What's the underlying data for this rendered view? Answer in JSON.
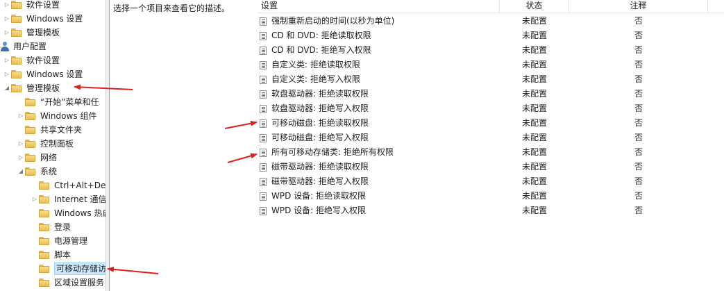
{
  "tree": [
    {
      "label": "软件设置",
      "toggle": "expand",
      "icon": "folder-icon",
      "name": "tree-software-settings-1"
    },
    {
      "label": "Windows 设置",
      "toggle": "expand",
      "icon": "folder-icon",
      "name": "tree-windows-settings-1"
    },
    {
      "label": "管理模板",
      "toggle": "expand",
      "icon": "folder-icon",
      "name": "tree-admin-templates-1"
    },
    {
      "label": "用户配置",
      "toggle": "none",
      "icon": "user-config-icon",
      "name": "tree-user-config"
    },
    {
      "label": "软件设置",
      "toggle": "expand",
      "icon": "folder-icon",
      "name": "tree-software-settings-2"
    },
    {
      "label": "Windows 设置",
      "toggle": "expand",
      "icon": "folder-icon",
      "name": "tree-windows-settings-2"
    },
    {
      "label": "管理模板",
      "toggle": "collapse",
      "icon": "folder-icon",
      "name": "tree-admin-templates-2"
    },
    {
      "label": "“开始”菜单和任",
      "toggle": "none",
      "icon": "folder-icon",
      "name": "tree-start-menu"
    },
    {
      "label": "Windows 组件",
      "toggle": "expand",
      "icon": "folder-icon",
      "name": "tree-windows-components"
    },
    {
      "label": "共享文件夹",
      "toggle": "none",
      "icon": "folder-icon",
      "name": "tree-shared-folders"
    },
    {
      "label": "控制面板",
      "toggle": "expand",
      "icon": "folder-icon",
      "name": "tree-control-panel"
    },
    {
      "label": "网络",
      "toggle": "expand",
      "icon": "folder-icon",
      "name": "tree-network"
    },
    {
      "label": "系统",
      "toggle": "collapse",
      "icon": "folder-icon",
      "name": "tree-system"
    },
    {
      "label": "Ctrl+Alt+Del",
      "toggle": "none",
      "icon": "folder-icon",
      "name": "tree-ctrl-alt-del"
    },
    {
      "label": "Internet 通信",
      "toggle": "expand",
      "icon": "folder-icon",
      "name": "tree-internet-comm"
    },
    {
      "label": "Windows 热启",
      "toggle": "none",
      "icon": "folder-icon",
      "name": "tree-windows-hotstart"
    },
    {
      "label": "登录",
      "toggle": "none",
      "icon": "folder-icon",
      "name": "tree-logon"
    },
    {
      "label": "电源管理",
      "toggle": "none",
      "icon": "folder-icon",
      "name": "tree-power-management"
    },
    {
      "label": "脚本",
      "toggle": "none",
      "icon": "folder-icon",
      "name": "tree-scripts"
    },
    {
      "label": "可移动存储访",
      "toggle": "none",
      "icon": "folder-icon",
      "name": "tree-removable-storage",
      "selected": true
    },
    {
      "label": "区域设置服务",
      "toggle": "none",
      "icon": "folder-icon",
      "name": "tree-locale-services"
    }
  ],
  "description": "选择一个项目来查看它的描述。",
  "columns": {
    "setting": "设置",
    "state": "状态",
    "note": "注释"
  },
  "policies": [
    {
      "setting": "强制重新启动的时间(以秒为单位)",
      "state": "未配置",
      "note": "否"
    },
    {
      "setting": "CD 和 DVD: 拒绝读取权限",
      "state": "未配置",
      "note": "否"
    },
    {
      "setting": "CD 和 DVD: 拒绝写入权限",
      "state": "未配置",
      "note": "否"
    },
    {
      "setting": "自定义类: 拒绝读取权限",
      "state": "未配置",
      "note": "否"
    },
    {
      "setting": "自定义类: 拒绝写入权限",
      "state": "未配置",
      "note": "否"
    },
    {
      "setting": "软盘驱动器: 拒绝读取权限",
      "state": "未配置",
      "note": "否"
    },
    {
      "setting": "软盘驱动器: 拒绝写入权限",
      "state": "未配置",
      "note": "否"
    },
    {
      "setting": "可移动磁盘: 拒绝读取权限",
      "state": "未配置",
      "note": "否"
    },
    {
      "setting": "可移动磁盘: 拒绝写入权限",
      "state": "未配置",
      "note": "否"
    },
    {
      "setting": "所有可移动存储类: 拒绝所有权限",
      "state": "未配置",
      "note": "否"
    },
    {
      "setting": "磁带驱动器: 拒绝读取权限",
      "state": "未配置",
      "note": "否"
    },
    {
      "setting": "磁带驱动器: 拒绝写入权限",
      "state": "未配置",
      "note": "否"
    },
    {
      "setting": "WPD 设备: 拒绝读取权限",
      "state": "未配置",
      "note": "否"
    },
    {
      "setting": "WPD 设备: 拒绝写入权限",
      "state": "未配置",
      "note": "否"
    }
  ],
  "annotation_color": "#e02020",
  "selection_color": "#cce8ff"
}
